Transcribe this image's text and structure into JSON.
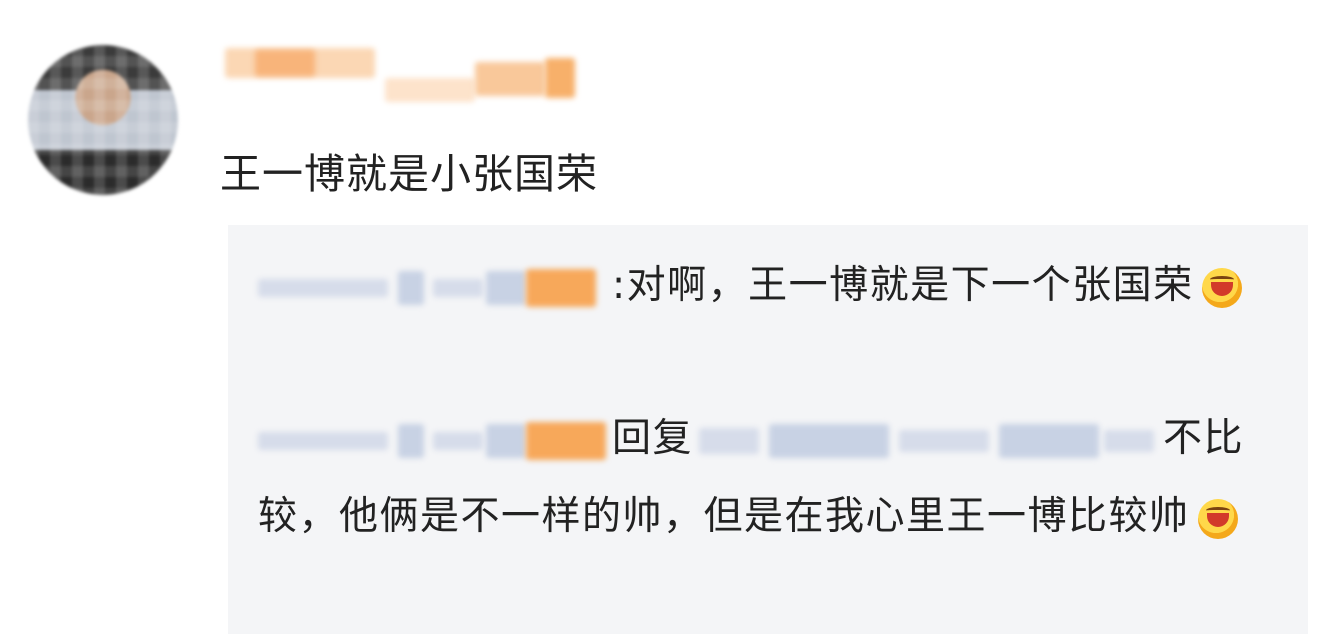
{
  "comment": {
    "text": "王一博就是小张国荣"
  },
  "replies": [
    {
      "separator": ":",
      "text": "对啊，王一博就是下一个张国荣"
    },
    {
      "reply_word": "回复",
      "text_a": "不",
      "text_b": "比较，他俩是不一样的帅，但是在我心里王一博比较帅"
    }
  ],
  "colors": {
    "reply_bg": "#f4f5f7",
    "blur_orange": "#f7a85a",
    "blur_blue": "#c8d2e4"
  },
  "icons": {
    "emoji": "laughing-emoji-icon"
  }
}
